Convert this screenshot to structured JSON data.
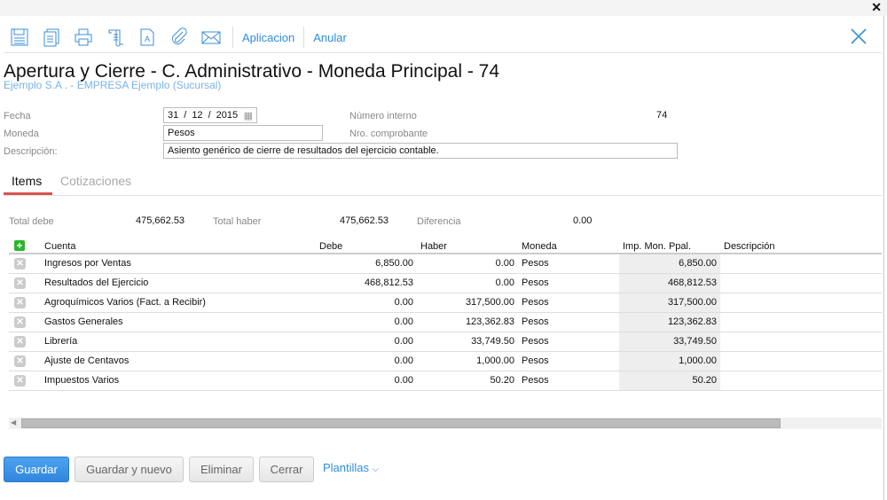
{
  "window": {
    "close": "✕"
  },
  "toolbar": {
    "aplicacion": "Aplicacion",
    "anular": "Anular"
  },
  "header": {
    "title": "Apertura y Cierre - C. Administrativo - Moneda Principal - 74",
    "subtitle": "Ejemplo S.A . - EMPRESA Ejemplo (Sucursal)"
  },
  "form": {
    "fecha_label": "Fecha",
    "fecha_day": "31",
    "fecha_month": "12",
    "fecha_year": "2015",
    "moneda_label": "Moneda",
    "moneda": "Pesos",
    "descripcion_label": "Descripción:",
    "descripcion": "Asiento genérico de cierre de resultados del ejercicio contable.",
    "numero_interno_label": "Número interno",
    "numero_interno": "74",
    "nro_comprobante_label": "Nro. comprobante"
  },
  "tabs": [
    {
      "label": "Items"
    },
    {
      "label": "Cotizaciones"
    }
  ],
  "totals": {
    "debe_label": "Total debe",
    "debe": "475,662.53",
    "haber_label": "Total haber",
    "haber": "475,662.53",
    "diferencia_label": "Diferencia",
    "diferencia": "0.00"
  },
  "table": {
    "headers": [
      "Cuenta",
      "Debe",
      "Haber",
      "Moneda",
      "Imp. Mon. Ppal.",
      "Descripción"
    ],
    "rows": [
      [
        "Ingresos por Ventas",
        "6,850.00",
        "0.00",
        "Pesos",
        "6,850.00",
        ""
      ],
      [
        "Resultados del Ejercicio",
        "468,812.53",
        "0.00",
        "Pesos",
        "468,812.53",
        ""
      ],
      [
        "Agroquímicos Varios (Fact. a Recibir)",
        "0.00",
        "317,500.00",
        "Pesos",
        "317,500.00",
        ""
      ],
      [
        "Gastos Generales",
        "0.00",
        "123,362.83",
        "Pesos",
        "123,362.83",
        ""
      ],
      [
        "Librería",
        "0.00",
        "33,749.50",
        "Pesos",
        "33,749.50",
        ""
      ],
      [
        "Ajuste de Centavos",
        "0.00",
        "1,000.00",
        "Pesos",
        "1,000.00",
        ""
      ],
      [
        "Impuestos Varios",
        "0.00",
        "50.20",
        "Pesos",
        "50.20",
        ""
      ]
    ]
  },
  "footer": {
    "guardar": "Guardar",
    "guardar_nuevo": "Guardar y nuevo",
    "eliminar": "Eliminar",
    "cerrar": "Cerrar",
    "plantillas": "Plantillas"
  }
}
